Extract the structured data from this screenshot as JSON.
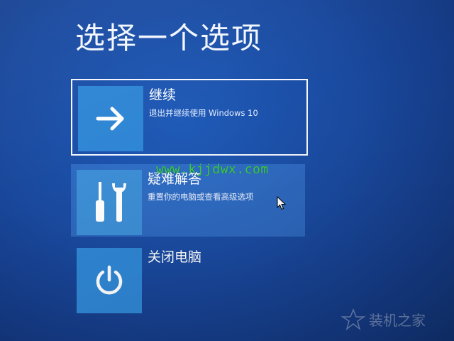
{
  "screen": {
    "title": "选择一个选项",
    "background_color": "#1a4aa0",
    "tile_color": "#2f86d4"
  },
  "options": [
    {
      "title": "继续",
      "description": "退出并继续使用 Windows 10",
      "icon": "arrow-right-icon",
      "state": "selected"
    },
    {
      "title": "疑难解答",
      "description": "重置你的电脑或查看高级选项",
      "icon": "screwdriver-wrench-icon",
      "state": "hovered"
    },
    {
      "title": "关闭电脑",
      "description": "",
      "icon": "power-icon",
      "state": "normal"
    }
  ],
  "overlay": {
    "watermark_text": "www.kjjdwx.com",
    "watermark_color": "#3ad03a",
    "corner_logo_text": "装机之家"
  }
}
